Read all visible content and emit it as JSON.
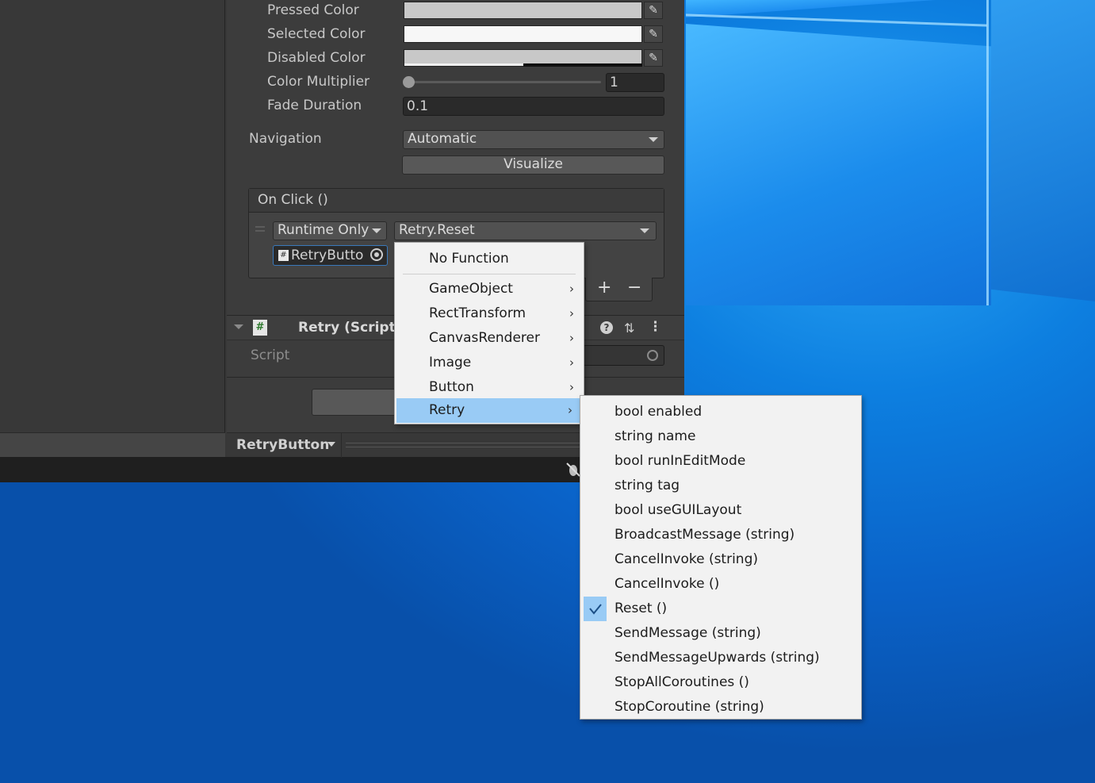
{
  "inspector": {
    "colors": [
      {
        "label": "Pressed Color",
        "swatch": "#c8c8c8"
      },
      {
        "label": "Selected Color",
        "swatch": "#f5f5f5"
      },
      {
        "label": "Disabled Color",
        "swatch": "#c8c8c8"
      }
    ],
    "color_multiplier": {
      "label": "Color Multiplier",
      "value": "1",
      "slider_fraction": 0.0
    },
    "fade_duration": {
      "label": "Fade Duration",
      "value": "0.1"
    },
    "navigation": {
      "label": "Navigation",
      "value": "Automatic"
    },
    "visualize_label": "Visualize",
    "onclick": {
      "header": "On Click ()",
      "runtime": "Runtime Only",
      "function": "Retry.Reset",
      "object": "RetryButto",
      "add": "+",
      "remove": "−"
    },
    "script_component": {
      "title": "Retry (Script)",
      "script_label": "Script"
    },
    "bottom_dropdown": "RetryButton"
  },
  "menu_main": {
    "items": [
      {
        "label": "No Function",
        "submenu": false
      },
      {
        "label": "GameObject",
        "submenu": true
      },
      {
        "label": "RectTransform",
        "submenu": true
      },
      {
        "label": "CanvasRenderer",
        "submenu": true
      },
      {
        "label": "Image",
        "submenu": true
      },
      {
        "label": "Button",
        "submenu": true
      },
      {
        "label": "Retry",
        "submenu": true,
        "highlighted": true
      }
    ]
  },
  "menu_retry": {
    "items": [
      {
        "label": "bool enabled"
      },
      {
        "label": "string name"
      },
      {
        "label": "bool runInEditMode"
      },
      {
        "label": "string tag"
      },
      {
        "label": "bool useGUILayout"
      },
      {
        "label": "BroadcastMessage (string)"
      },
      {
        "label": "CancelInvoke (string)"
      },
      {
        "label": "CancelInvoke ()"
      },
      {
        "label": "Reset ()",
        "checked": true
      },
      {
        "label": "SendMessage (string)"
      },
      {
        "label": "SendMessageUpwards (string)"
      },
      {
        "label": "StopAllCoroutines ()"
      },
      {
        "label": "StopCoroutine (string)"
      }
    ]
  },
  "colors": {
    "highlight": "#99cbf5",
    "check_bg": "#99cbf5",
    "menu_bg": "#f2f2f2"
  }
}
